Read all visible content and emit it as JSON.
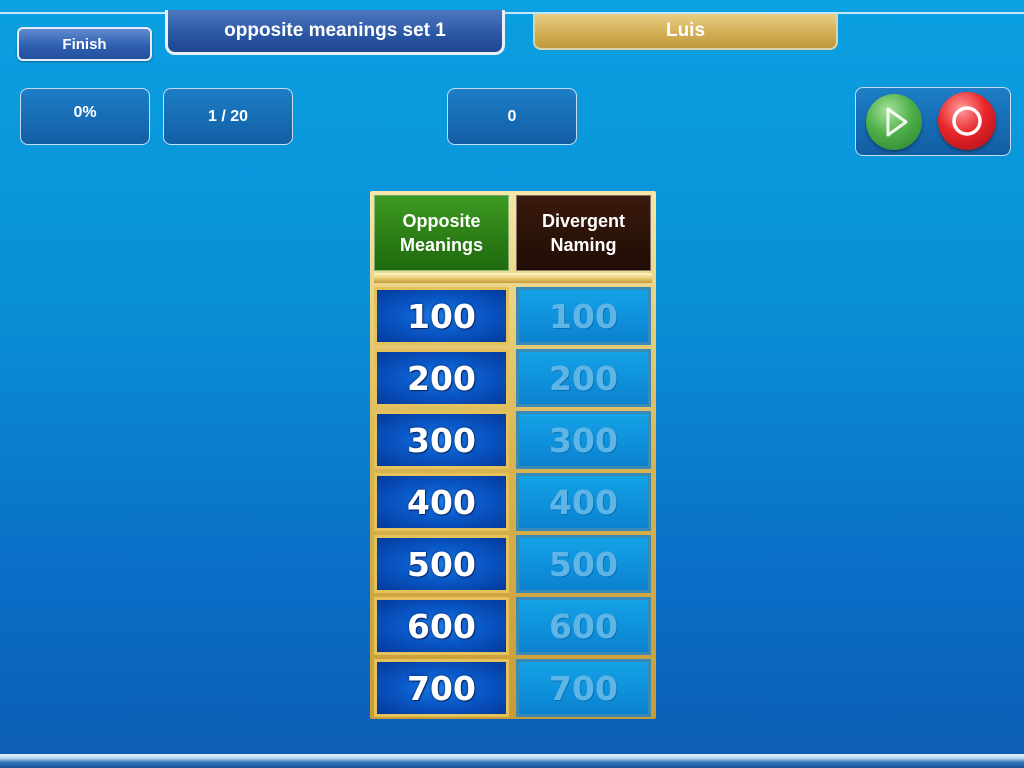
{
  "header": {
    "finish_label": "Finish",
    "game_title": "opposite meanings set 1",
    "player_name": "Luis"
  },
  "stats": {
    "percent": "0%",
    "progress": "1 / 20",
    "score": "0"
  },
  "controls": {
    "play_icon": "play-icon",
    "stop_icon": "stop-icon",
    "colors": {
      "play": "#3fa23f",
      "stop": "#e8262a"
    }
  },
  "board": {
    "categories": [
      {
        "label": "Opposite Meanings",
        "color": "#2a7b14"
      },
      {
        "label": "Divergent Naming",
        "color": "#2a1208"
      }
    ],
    "columns": [
      [
        "100",
        "200",
        "300",
        "400",
        "500",
        "600",
        "700"
      ],
      [
        "100",
        "200",
        "300",
        "400",
        "500",
        "600",
        "700"
      ]
    ],
    "column_state": [
      "available",
      "used"
    ]
  }
}
